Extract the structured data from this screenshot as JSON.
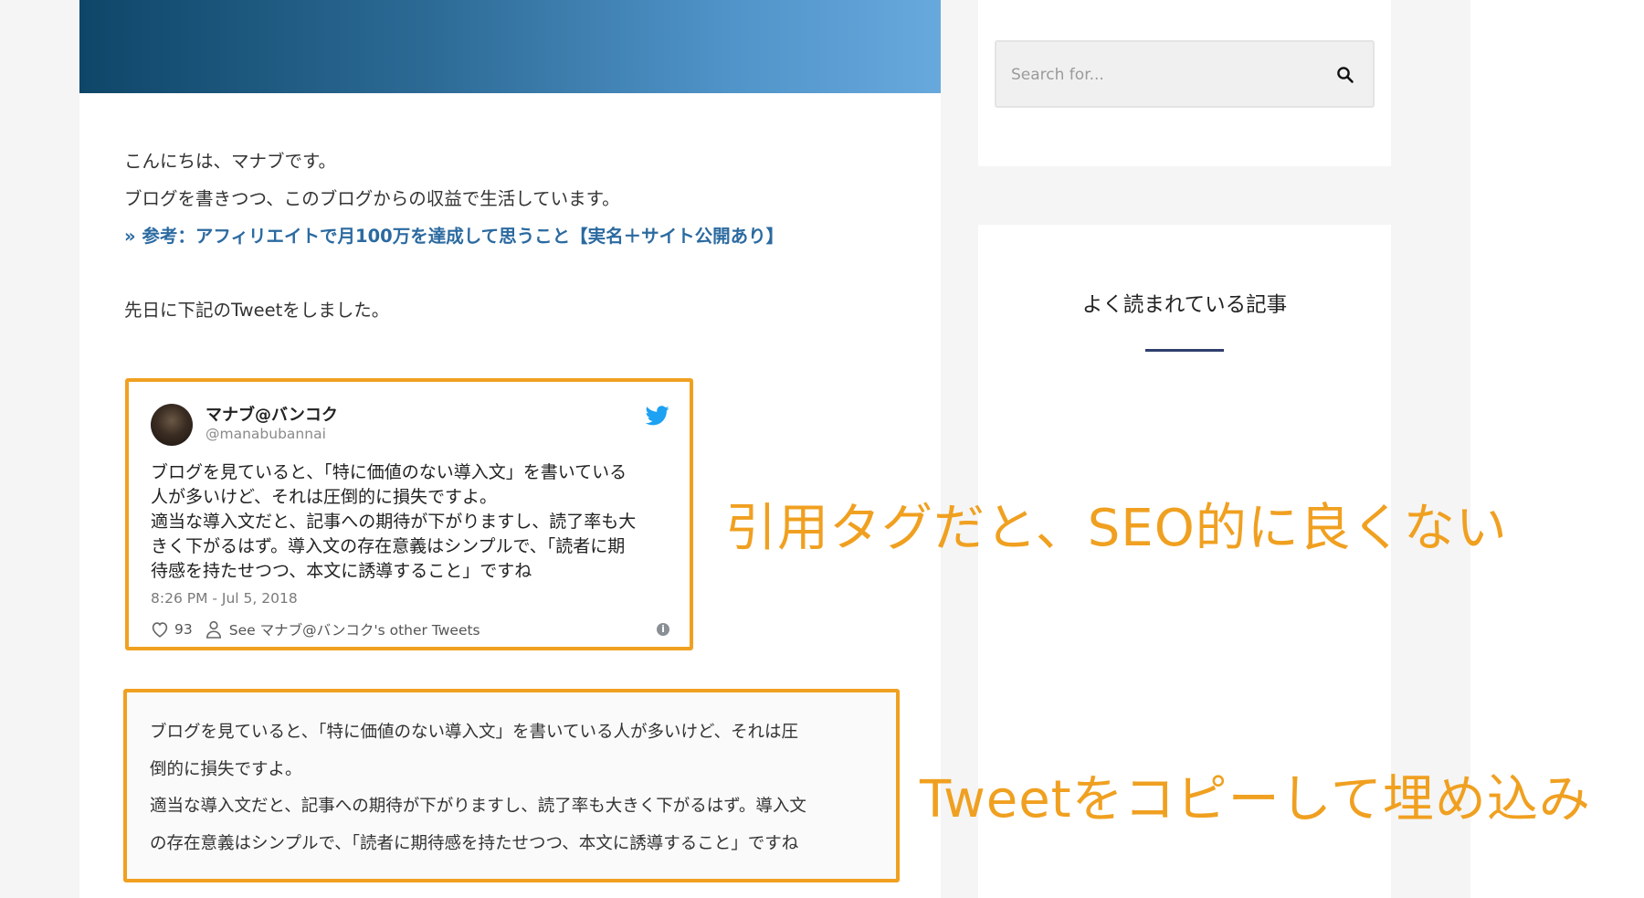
{
  "article": {
    "greeting": "こんにちは、マナブです。",
    "intro": "ブログを書きつつ、このブログからの収益で生活しています。",
    "reference_link": "» 参考：アフィリエイトで月100万を達成して思うこと【実名＋サイト公開あり】",
    "tweet_intro": "先日に下記のTweetをしました。"
  },
  "tweet": {
    "name": "マナブ@バンコク",
    "handle": "@manabubannai",
    "lines": [
      "ブログを見ていると、「特に価値のない導入文」を書いている",
      "人が多いけど、それは圧倒的に損失ですよ。",
      "適当な導入文だと、記事への期待が下がりますし、読了率も大",
      "きく下がるはず。導入文の存在意義はシンプルで、「読者に期",
      "待感を持たせつつ、本文に誘導すること」ですね"
    ],
    "date": "8:26 PM - Jul 5, 2018",
    "likes": "93",
    "see_other": "See マナブ@バンコク's other Tweets",
    "info_glyph": "i"
  },
  "copied_tweet": {
    "lines": [
      "ブログを見ていると、「特に価値のない導入文」を書いている人が多いけど、それは圧",
      "倒的に損失ですよ。",
      "適当な導入文だと、記事への期待が下がりますし、読了率も大きく下がるはず。導入文",
      "の存在意義はシンプルで、「読者に期待感を持たせつつ、本文に誘導すること」ですね"
    ]
  },
  "sidebar": {
    "search_placeholder": "Search for...",
    "popular_title": "よく読まれている記事"
  },
  "annotations": {
    "quote_tag": "引用タグだと、SEO的に良くない",
    "copy_embed": "Tweetをコピーして埋め込み"
  },
  "colors": {
    "accent_orange": "#f0a020",
    "link_blue": "#2b6aa0",
    "twitter_blue": "#1da1f2",
    "underline_navy": "#2e3f6e"
  },
  "icons": {
    "search": "search-icon",
    "twitter": "twitter-bird-icon",
    "heart": "heart-icon",
    "person": "person-icon",
    "info": "info-icon"
  }
}
